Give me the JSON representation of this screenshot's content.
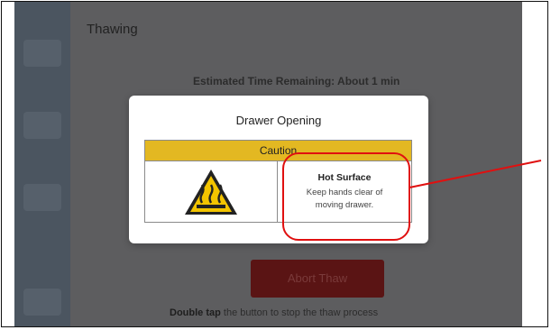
{
  "screen": {
    "title": "Thawing",
    "estimate": "Estimated Time Remaining: About 1 min",
    "abort_label": "Abort Thaw",
    "hint_bold": "Double tap",
    "hint_rest": "the button to stop the thaw process"
  },
  "dialog": {
    "title": "Drawer Opening",
    "caution_label": "Caution",
    "hazard_icon": "hot-surface-warning-icon",
    "hazard_title": "Hot Surface",
    "hazard_desc": "Keep hands clear of moving drawer."
  },
  "colors": {
    "caution_yellow": "#e3b822",
    "annotation_red": "#e01010",
    "abort_red": "#5a1414"
  }
}
